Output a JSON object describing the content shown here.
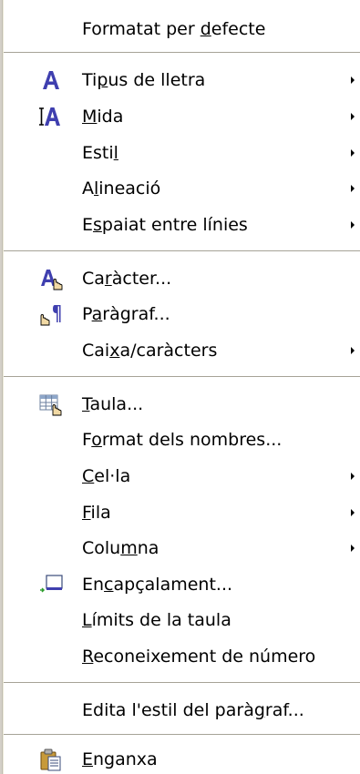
{
  "menu": {
    "items": [
      {
        "key": "formatat",
        "pre": "Formatat per ",
        "acc": "d",
        "post": "efecte",
        "submenu": false
      },
      {
        "key": "tipus",
        "pre": "Ti",
        "acc": "p",
        "post": "us de lletra",
        "submenu": true,
        "icon": "font-name-icon"
      },
      {
        "key": "mida",
        "pre": "",
        "acc": "M",
        "post": "ida",
        "submenu": true,
        "icon": "font-size-icon"
      },
      {
        "key": "estil",
        "pre": "Esti",
        "acc": "l",
        "post": "",
        "submenu": true
      },
      {
        "key": "alineacio",
        "pre": "A",
        "acc": "l",
        "post": "ineació",
        "submenu": true
      },
      {
        "key": "espaiat",
        "pre": "E",
        "acc": "s",
        "post": "paiat entre línies",
        "submenu": true
      },
      {
        "key": "caracter",
        "pre": "Ca",
        "acc": "r",
        "post": "àcter...",
        "submenu": false,
        "icon": "character-icon"
      },
      {
        "key": "paragraf",
        "pre": "P",
        "acc": "a",
        "post": "ràgraf...",
        "submenu": false,
        "icon": "paragraph-icon"
      },
      {
        "key": "caixa",
        "pre": "Cai",
        "acc": "x",
        "post": "a/caràcters",
        "submenu": true
      },
      {
        "key": "taula",
        "pre": "",
        "acc": "T",
        "post": "aula...",
        "submenu": false,
        "icon": "table-icon"
      },
      {
        "key": "format_nombres",
        "pre": "F",
        "acc": "o",
        "post": "rmat dels nombres...",
        "submenu": false
      },
      {
        "key": "cella",
        "pre": "",
        "acc": "C",
        "post": "el·la",
        "submenu": true
      },
      {
        "key": "fila",
        "pre": "",
        "acc": "F",
        "post": "ila",
        "submenu": true
      },
      {
        "key": "columna",
        "pre": "Colu",
        "acc": "m",
        "post": "na",
        "submenu": true
      },
      {
        "key": "encapcalament",
        "pre": "En",
        "acc": "c",
        "post": "apçalament...",
        "submenu": false,
        "icon": "heading-icon"
      },
      {
        "key": "limits",
        "pre": "",
        "acc": "L",
        "post": "ímits de la taula",
        "submenu": false
      },
      {
        "key": "reconeixement",
        "pre": "",
        "acc": "R",
        "post": "econeixement de número",
        "submenu": false
      },
      {
        "key": "edita_estil",
        "pre": "Edita l'estil del parà",
        "acc": "g",
        "post": "raf...",
        "submenu": false
      },
      {
        "key": "enganxa",
        "pre": "",
        "acc": "E",
        "post": "nganxa",
        "submenu": false,
        "icon": "paste-icon"
      }
    ]
  },
  "colors": {
    "font_icon": "#3f3faf",
    "menu_bg": "#ffffff",
    "separator": "#a6a397"
  }
}
